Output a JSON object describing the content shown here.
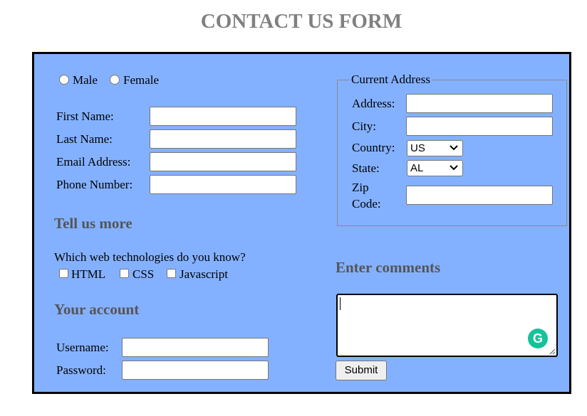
{
  "page_title": "CONTACT US FORM",
  "gender": {
    "options": [
      "Male",
      "Female"
    ]
  },
  "personal": {
    "first_name_label": "First Name:",
    "last_name_label": "Last Name:",
    "email_label": "Email Address:",
    "phone_label": "Phone Number:",
    "first_name_value": "",
    "last_name_value": "",
    "email_value": "",
    "phone_value": ""
  },
  "tell_us_more": {
    "heading": "Tell us more",
    "question": "Which web technologies do you know?",
    "technologies": [
      "HTML",
      "CSS",
      "Javascript"
    ]
  },
  "account": {
    "heading": "Your account",
    "username_label": "Username:",
    "password_label": "Password:",
    "username_value": "",
    "password_value": ""
  },
  "address": {
    "legend": "Current Address",
    "address_label": "Address:",
    "city_label": "City:",
    "country_label": "Country:",
    "state_label": "State:",
    "zip_label_line1": "Zip",
    "zip_label_line2": "Code:",
    "country_selected": "US",
    "state_selected": "AL"
  },
  "comments": {
    "heading": "Enter comments",
    "value": ""
  },
  "submit_label": "Submit",
  "colors": {
    "form_background": "#84b1ff",
    "heading_gray": "#555555",
    "title_gray": "#808080",
    "grammarly_green": "#15c39a"
  },
  "icons": [
    "radio-icon",
    "checkbox-icon",
    "chevron-down-icon",
    "grammarly-icon",
    "resize-grip-icon"
  ]
}
